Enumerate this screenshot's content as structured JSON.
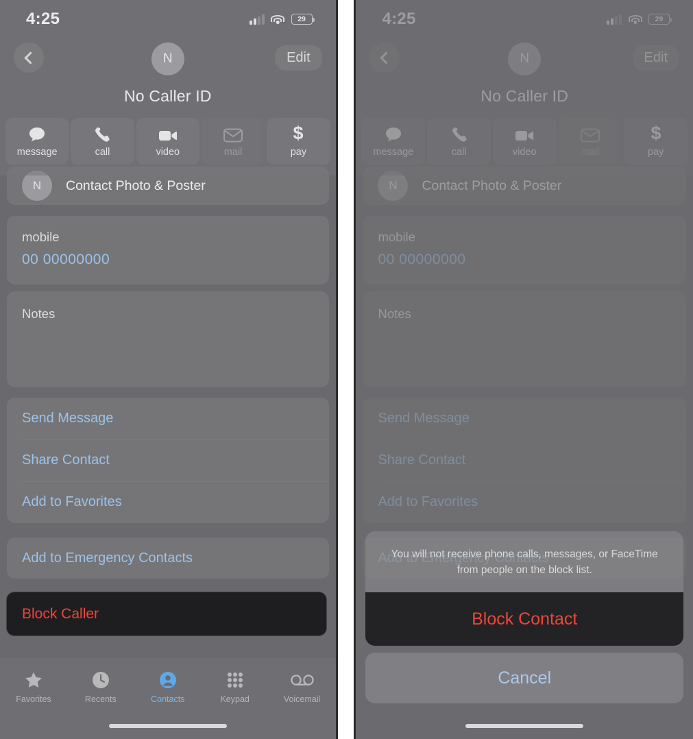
{
  "status_bar": {
    "time": "4:25",
    "battery_percent": "29",
    "signal_icon": "cellular-bars-icon",
    "wifi_icon": "wifi-icon",
    "battery_icon": "battery-icon"
  },
  "nav": {
    "back_icon": "chevron-left-icon",
    "edit_label": "Edit",
    "avatar_initial": "N",
    "contact_name": "No Caller ID"
  },
  "quick_actions": [
    {
      "label": "message",
      "icon": "message-bubble-icon",
      "disabled": false
    },
    {
      "label": "call",
      "icon": "phone-handset-icon",
      "disabled": false
    },
    {
      "label": "video",
      "icon": "video-camera-icon",
      "disabled": false
    },
    {
      "label": "mail",
      "icon": "mail-envelope-icon",
      "disabled": true
    },
    {
      "label": "pay",
      "icon": "dollar-sign-icon",
      "disabled": false
    }
  ],
  "photo_poster_row": {
    "initial": "N",
    "label": "Contact Photo & Poster"
  },
  "phone_field": {
    "label": "mobile",
    "value": "00 00000000"
  },
  "notes": {
    "label": "Notes",
    "value": ""
  },
  "links": [
    {
      "label": "Send Message"
    },
    {
      "label": "Share Contact"
    },
    {
      "label": "Add to Favorites"
    }
  ],
  "emergency": {
    "label": "Add to Emergency Contacts"
  },
  "block": {
    "label": "Block Caller"
  },
  "tabbar": [
    {
      "label": "Favorites",
      "icon": "star-icon",
      "active": false
    },
    {
      "label": "Recents",
      "icon": "clock-icon",
      "active": false
    },
    {
      "label": "Contacts",
      "icon": "person-circle-icon",
      "active": true
    },
    {
      "label": "Keypad",
      "icon": "keypad-dots-icon",
      "active": false
    },
    {
      "label": "Voicemail",
      "icon": "voicemail-icon",
      "active": false
    }
  ],
  "action_sheet": {
    "message": "You will not receive phone calls, messages, or FaceTime from people on the block list.",
    "block_label": "Block Contact",
    "cancel_label": "Cancel"
  },
  "colors": {
    "accent_blue": "#9cc2e8",
    "destructive_red": "#f04438",
    "screen_bg": "#6a6a6e",
    "highlight_bg": "#1e1e20"
  }
}
